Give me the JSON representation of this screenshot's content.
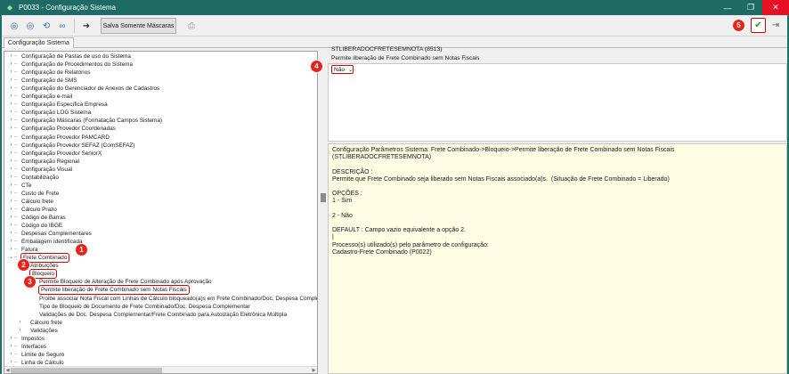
{
  "window": {
    "title": "P0033 - Configuração Sistema",
    "controls": [
      "minimize",
      "maximize",
      "close"
    ]
  },
  "toolbar": {
    "masks_button_label": "Salva Somente Máscaras"
  },
  "tabs": [
    {
      "label": "Configuração Sistema"
    }
  ],
  "tree": {
    "items": [
      {
        "label": "Configuração de Pastas de uso do Sistema",
        "level": 0,
        "expander": ">"
      },
      {
        "label": "Configuração de Procedimentos do Sistema",
        "level": 0,
        "expander": ">"
      },
      {
        "label": "Configuração de Relatórios",
        "level": 0,
        "expander": ">"
      },
      {
        "label": "Configuração de SMS",
        "level": 0,
        "expander": ">"
      },
      {
        "label": "Configuração do Gerenciador de Anexos de Cadastros",
        "level": 0,
        "expander": ">"
      },
      {
        "label": "Configuração e-mail",
        "level": 0,
        "expander": ">"
      },
      {
        "label": "Configuração Específica Empresa",
        "level": 0,
        "expander": ">"
      },
      {
        "label": "Configuração LOG Sistema",
        "level": 0,
        "expander": ">"
      },
      {
        "label": "Configuração Máscaras (Formatação Campos Sistema)",
        "level": 0,
        "expander": ">"
      },
      {
        "label": "Configuração Provedor Coordenadas",
        "level": 0,
        "expander": ">"
      },
      {
        "label": "Configuração Provedor PAMCARD",
        "level": 0,
        "expander": ">"
      },
      {
        "label": "Configuração Provedor SEFAZ (ComSEFAZ)",
        "level": 0,
        "expander": ">"
      },
      {
        "label": "Configuração Provedor SeniorX",
        "level": 0,
        "expander": ">"
      },
      {
        "label": "Configuração Regional",
        "level": 0,
        "expander": ">"
      },
      {
        "label": "Configuração Visual",
        "level": 0,
        "expander": ">"
      },
      {
        "label": "Contabilização",
        "level": 0,
        "expander": ">"
      },
      {
        "label": "CTe",
        "level": 0,
        "expander": ">"
      },
      {
        "label": "Custo de Frete",
        "level": 0,
        "expander": ">"
      },
      {
        "label": "Cálculo frete",
        "level": 0,
        "expander": ">"
      },
      {
        "label": "Cálculo Prazo",
        "level": 0,
        "expander": ">"
      },
      {
        "label": "Código de Barras",
        "level": 0,
        "expander": ">"
      },
      {
        "label": "Código do IBGE",
        "level": 0,
        "expander": ">"
      },
      {
        "label": "Despesas Complementares",
        "level": 0,
        "expander": ">"
      },
      {
        "label": "Embalagem Identificada",
        "level": 0,
        "expander": ">"
      },
      {
        "label": "Fatura",
        "level": 0,
        "expander": ">"
      },
      {
        "label": "Frete Combinado",
        "level": 0,
        "expander": "v",
        "highlight": true
      },
      {
        "label": "Atribuições",
        "level": 1,
        "expander": ""
      },
      {
        "label": "Bloqueio",
        "level": 1,
        "expander": "",
        "highlight": true
      },
      {
        "label": "Permite Bloqueio de Alteração de Frete Combinado após Aprovação",
        "level": 2,
        "expander": ""
      },
      {
        "label": "Permite liberação de Frete Combinado sem Notas Fiscais",
        "level": 2,
        "expander": "",
        "highlight": true
      },
      {
        "label": "Proibe associar Nota Fiscal com Linhas de Cálculo bloqueado(a)s em Frete Combinado/Doc. Despesa Complementar",
        "level": 2,
        "expander": ""
      },
      {
        "label": "Tipo de Bloqueio de Documento de Frete Combinado/Doc. Despesa Complementar",
        "level": 2,
        "expander": ""
      },
      {
        "label": "Validações de Doc. Despesa Complementar/Frete Combinado para Autoização Eletrônica Múltipla",
        "level": 2,
        "expander": ""
      },
      {
        "label": "Cálculo frete",
        "level": 1,
        "expander": ">"
      },
      {
        "label": "Validações",
        "level": 1,
        "expander": ">"
      },
      {
        "label": "Impostos",
        "level": 0,
        "expander": ">"
      },
      {
        "label": "Interfaces",
        "level": 0,
        "expander": ">"
      },
      {
        "label": "Limite de Seguro",
        "level": 0,
        "expander": ">"
      },
      {
        "label": "Linha de Cálculo",
        "level": 0,
        "expander": ">"
      }
    ]
  },
  "detail": {
    "param_code": "STLIBERADOCFRETESEMNOTA (8513)",
    "param_title": "Permite liberação de Frete Combinado sem Notas Fiscais",
    "selected_value": "Não",
    "help_lines": [
      "Configuração Parâmetros Sistema: Frete Combinado->Bloqueio->Permite liberação de Frete Combinado sem Notas Fiscais",
      "(STLIBERADOCFRETESEMNOTA)",
      "",
      "DESCRIÇÃO :",
      "Permite que Frete Combinado seja liberado sem Notas Fiscais associado(a)s.  (Situação de Frete Combinado = Liberado)",
      "",
      "OPÇÕES :",
      "1 - Sim",
      "",
      "2 - Não",
      "",
      "DEFAULT : Campo vazio equivalente a opção 2.",
      "|",
      "Processo(s) utilizado(s) pelo parâmetro de configuração:",
      "Cadastro-Frete Combinado (P0022)"
    ]
  },
  "badges": [
    "1",
    "2",
    "3",
    "4",
    "5"
  ],
  "colors": {
    "titlebar": "#1e6b66",
    "badge": "#e8231b",
    "help_bg": "#fffde4",
    "highlight": "#d40000"
  }
}
